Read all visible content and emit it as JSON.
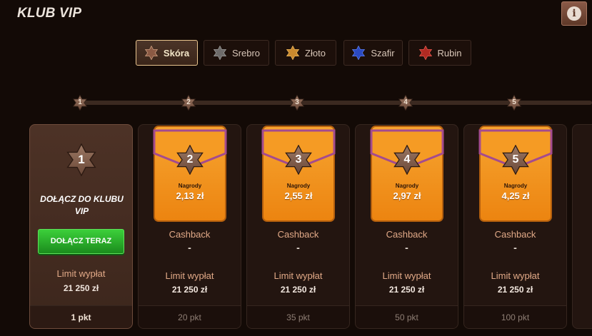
{
  "header": {
    "title": "KLUB VIP",
    "info_icon": "info-icon"
  },
  "tabs": [
    {
      "label": "Skóra",
      "star_color": "#8b5a44",
      "active": true
    },
    {
      "label": "Srebro",
      "star_color": "#6d6b6a",
      "active": false
    },
    {
      "label": "Złoto",
      "star_color": "#c9892e",
      "active": false
    },
    {
      "label": "Szafir",
      "star_color": "#2a49c2",
      "active": false
    },
    {
      "label": "Rubin",
      "star_color": "#b02a22",
      "active": false
    }
  ],
  "progress": {
    "markers": [
      "1",
      "2",
      "3",
      "4",
      "5"
    ]
  },
  "levels": [
    {
      "number": "1",
      "join_title": "DOŁĄCZ DO KLUBU VIP",
      "join_button": "DOŁĄCZ TERAZ",
      "limit_label": "Limit wypłat",
      "limit_value": "21 250 zł",
      "points": "1 pkt"
    },
    {
      "number": "2",
      "rewards_label": "Nagrody",
      "rewards_amount": "2,13 zł",
      "cashback_label": "Cashback",
      "cashback_value": "-",
      "limit_label": "Limit wypłat",
      "limit_value": "21 250 zł",
      "points": "20 pkt"
    },
    {
      "number": "3",
      "rewards_label": "Nagrody",
      "rewards_amount": "2,55 zł",
      "cashback_label": "Cashback",
      "cashback_value": "-",
      "limit_label": "Limit wypłat",
      "limit_value": "21 250 zł",
      "points": "35 pkt"
    },
    {
      "number": "4",
      "rewards_label": "Nagrody",
      "rewards_amount": "2,97 zł",
      "cashback_label": "Cashback",
      "cashback_value": "-",
      "limit_label": "Limit wypłat",
      "limit_value": "21 250 zł",
      "points": "50 pkt"
    },
    {
      "number": "5",
      "rewards_label": "Nagrody",
      "rewards_amount": "4,25 zł",
      "cashback_label": "Cashback",
      "cashback_value": "-",
      "limit_label": "Limit wypłat",
      "limit_value": "21 250 zł",
      "points": "100 pkt"
    }
  ],
  "colors": {
    "background": "#130a06",
    "accent_gold": "#e8c48e",
    "join_green": "#2fb52d",
    "envelope_orange": "#f39a22",
    "label_peach": "#e1a987"
  }
}
